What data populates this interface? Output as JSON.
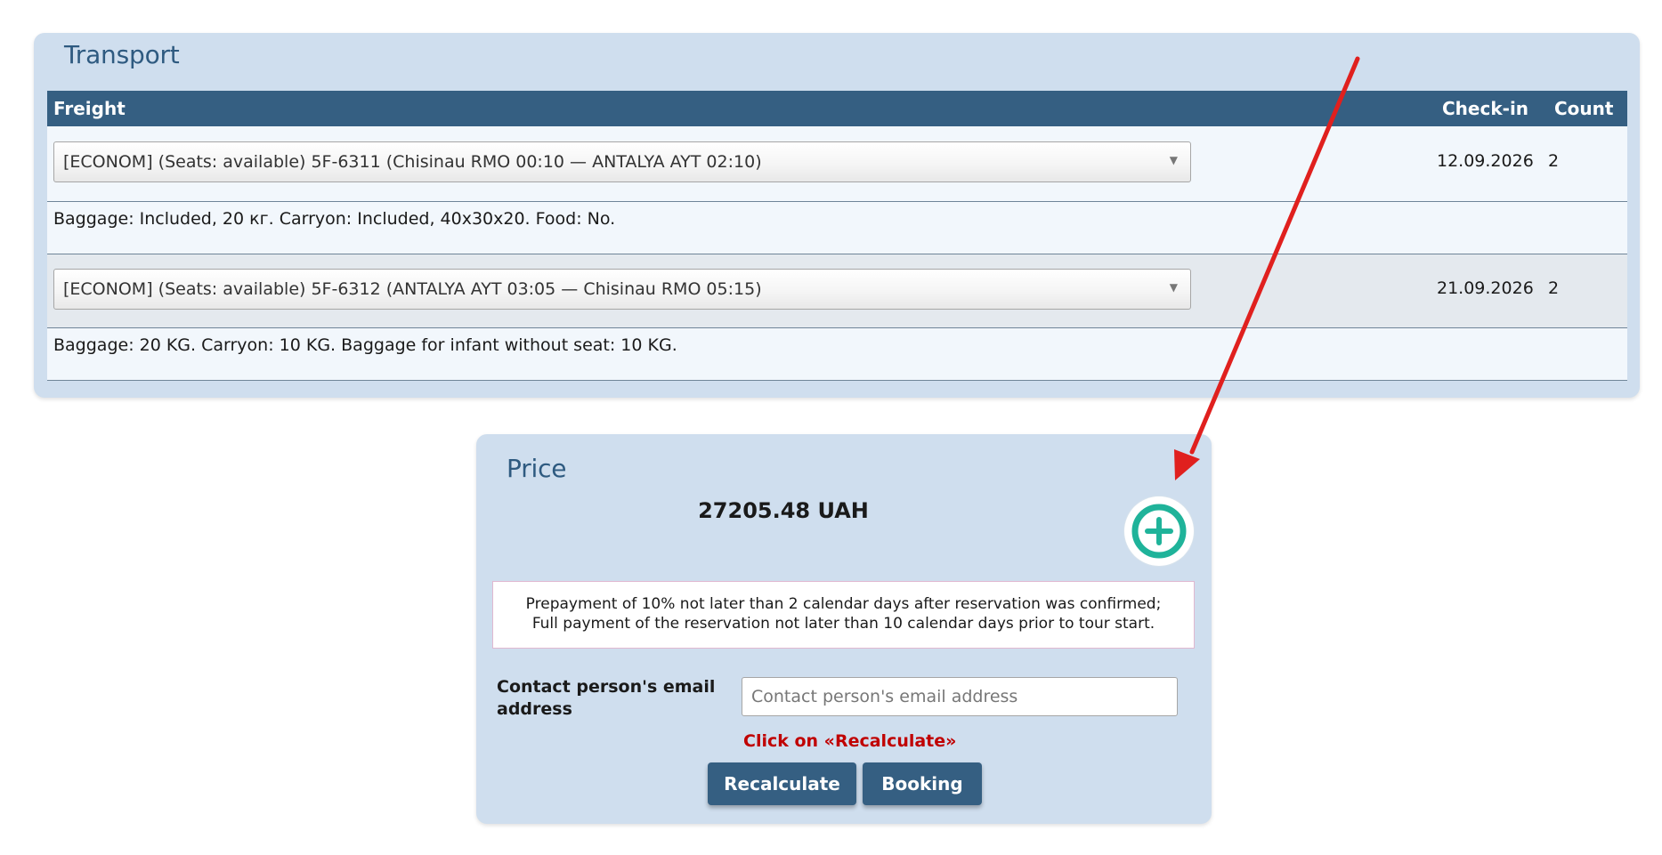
{
  "transport": {
    "title": "Transport",
    "columns": {
      "freight": "Freight",
      "checkin": "Check-in",
      "count": "Count"
    },
    "rows": [
      {
        "selected": "[ECONOM] (Seats: available) 5F-6311 (Chisinau RMO 00:10 — ANTALYA AYT 02:10)",
        "checkin": "12.09.2026",
        "count": "2",
        "info": "Baggage: Included, 20 кг. Carryon: Included, 40x30x20. Food: No.",
        "bg": "#f2f7fc"
      },
      {
        "selected": "[ECONOM] (Seats: available) 5F-6312 (ANTALYA AYT 03:05 — Chisinau RMO 05:15)",
        "checkin": "21.09.2026",
        "count": "2",
        "info": "Baggage: 20 KG. Carryon: 10 KG. Baggage for infant without seat: 10 KG.",
        "bg": "#e4e9ee"
      }
    ]
  },
  "price": {
    "title": "Price",
    "amount": "27205.48 UAH",
    "terms_line1": "Prepayment of 10% not later than 2 calendar days after reservation was confirmed;",
    "terms_line2": "Full payment of the reservation not later than 10 calendar days prior to tour start.",
    "email_label": "Contact person's email address",
    "email_value": "",
    "email_placeholder": "Contact person's email address",
    "hint": "Click on «Recalculate»",
    "recalc_label": "Recalculate",
    "booking_label": "Booking"
  },
  "icons": {
    "add": "plus-circle-icon",
    "select_arrow": "caret-down-icon"
  },
  "colors": {
    "header": "#355f82",
    "panel": "#cfdeee",
    "accent": "#1fb39a",
    "hint": "#c00000",
    "annotation": "#e0201e"
  }
}
